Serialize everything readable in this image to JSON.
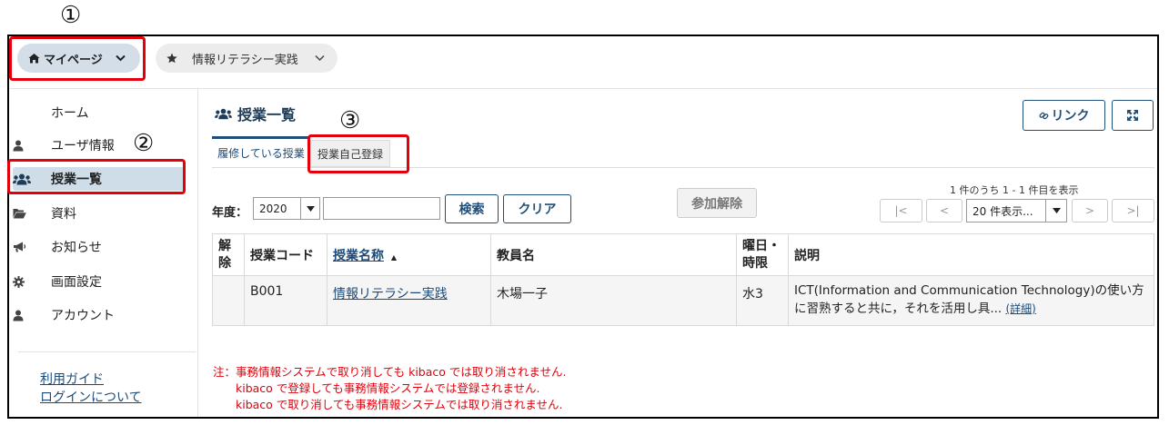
{
  "annotations": {
    "n1": "①",
    "n2": "②",
    "n3": "③"
  },
  "topbar": {
    "home_pill": "マイページ",
    "course_pill": "情報リテラシー実践"
  },
  "sidebar": {
    "items": [
      {
        "label": "ホーム"
      },
      {
        "label": "ユーザ情報"
      },
      {
        "label": "授業一覧"
      },
      {
        "label": "資料"
      },
      {
        "label": "お知らせ"
      },
      {
        "label": "画面設定"
      },
      {
        "label": "アカウント"
      }
    ],
    "links": [
      "利用ガイド",
      "ログインについて"
    ]
  },
  "main": {
    "title": "授業一覧",
    "link_button": "リンク",
    "tabs": [
      "履修している授業",
      "授業自己登録"
    ],
    "year_label": "年度：",
    "year_value": "2020",
    "search_value": "",
    "search_button": "検索",
    "clear_button": "クリア",
    "remove_button": "参加解除",
    "page_info": "1 件のうち 1 - 1 件目を表示",
    "pager": {
      "first": "|<",
      "prev": "<",
      "per_page": "20 件表示...",
      "next": ">",
      "last": ">|"
    },
    "table": {
      "headers": {
        "remove": "解\n除",
        "code": "授業コード",
        "name": "授業名称",
        "sort_mark": "▲",
        "teacher": "教員名",
        "day": "曜日・\n時限",
        "desc": "説明"
      },
      "rows": [
        {
          "remove": "",
          "code": "B001",
          "name": "情報リテラシー実践",
          "teacher": "木場一子",
          "day": "水3",
          "desc_line1": "ICT(Information and Communication Technology)の使い方",
          "desc_line2": "に習熟すると共に，それを活用し具...",
          "detail": "(詳細)"
        }
      ]
    },
    "notes": [
      "注：事務情報システムで取り消しても kibaco では取り消されません.",
      "kibaco で登録しても事務情報システムでは登録されません.",
      "kibaco で取り消しても事務情報システムでは取り消されません."
    ]
  },
  "colors": {
    "accent": "#1f4e79",
    "annotation_red": "#e3000b",
    "note_red": "#e3000b",
    "active_nav": "#cfdde8"
  }
}
